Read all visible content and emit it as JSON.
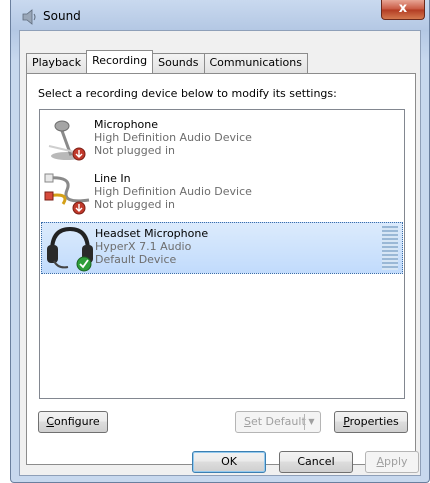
{
  "window": {
    "title": "Sound",
    "close_glyph": "x"
  },
  "tabs": [
    {
      "label": "Playback",
      "active": false
    },
    {
      "label": "Recording",
      "active": true
    },
    {
      "label": "Sounds",
      "active": false
    },
    {
      "label": "Communications",
      "active": false
    }
  ],
  "instruction": "Select a recording device below to modify its settings:",
  "devices": [
    {
      "name": "Microphone",
      "driver": "High Definition Audio Device",
      "status": "Not plugged in",
      "icon": "microphone-icon",
      "badge": "down-arrow-red"
    },
    {
      "name": "Line In",
      "driver": "High Definition Audio Device",
      "status": "Not plugged in",
      "icon": "line-in-cable-icon",
      "badge": "down-arrow-red"
    },
    {
      "name": "Headset Microphone",
      "driver": "HyperX 7.1 Audio",
      "status": "Default Device",
      "icon": "headset-icon",
      "badge": "green-check",
      "selected": true
    }
  ],
  "buttons": {
    "configure": {
      "first": "C",
      "rest": "onfigure"
    },
    "set_default": {
      "first": "S",
      "rest": "et Default"
    },
    "properties": {
      "first": "P",
      "rest": "roperties"
    },
    "ok": "OK",
    "cancel": "Cancel",
    "apply": {
      "first": "A",
      "rest": "pply"
    }
  },
  "colors": {
    "selection": "#c1dbfc",
    "accent": "#3d6ea8",
    "close": "#c7563f"
  }
}
